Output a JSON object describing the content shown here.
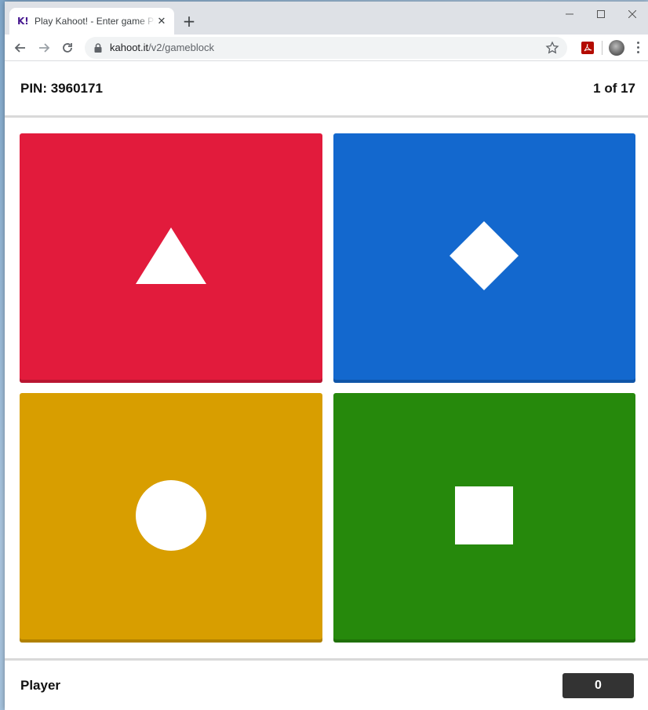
{
  "browser": {
    "tab": {
      "favicon": "K!",
      "title": "Play Kahoot! - Enter game PIN here",
      "close": "✕"
    },
    "new_tab": "+",
    "url_host": "kahoot.it",
    "url_path": "/v2/gameblock"
  },
  "game": {
    "pin_label": "PIN: 3960171",
    "question_counter": "1 of 17",
    "answers": [
      {
        "shape": "triangle-icon",
        "color": "#e21b3c"
      },
      {
        "shape": "diamond-icon",
        "color": "#1368ce"
      },
      {
        "shape": "circle-icon",
        "color": "#d89e00"
      },
      {
        "shape": "square-icon",
        "color": "#26890c"
      }
    ],
    "player_name": "Player",
    "score": "0"
  }
}
